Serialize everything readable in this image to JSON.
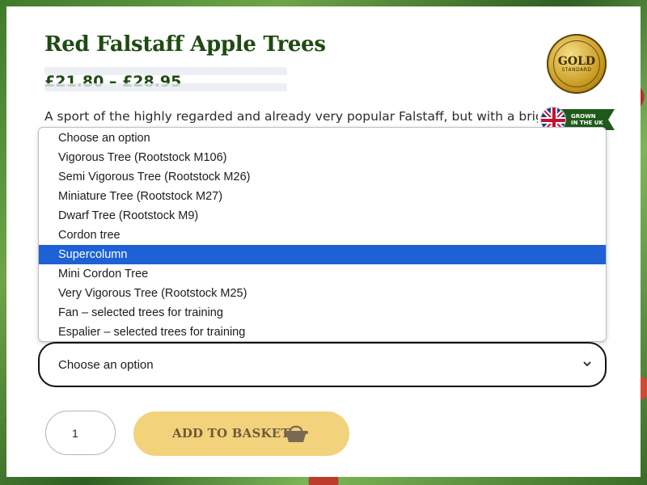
{
  "product": {
    "title": "Red Falstaff Apple Trees",
    "price": "£21.80 – £28.95",
    "description": "A sport of the highly regarded and already very popular Falstaff, but with a bright"
  },
  "badges": {
    "gold": {
      "word": "GOLD",
      "sub": "STANDARD"
    },
    "uk": {
      "line1": "GROWN",
      "line2": "IN THE UK"
    }
  },
  "rootstock_select": {
    "value": "Choose an option",
    "options": [
      "Choose an option",
      "Vigorous Tree (Rootstock M106)",
      "Semi Vigorous Tree (Rootstock M26)",
      "Miniature Tree (Rootstock M27)",
      "Dwarf Tree (Rootstock M9)",
      "Cordon tree",
      "Supercolumn",
      "Mini Cordon Tree",
      "Very Vigorous Tree (Rootstock M25)",
      "Fan – selected trees for training",
      "Espalier – selected trees for training"
    ],
    "highlighted": "Supercolumn"
  },
  "cart": {
    "quantity": "1",
    "button_label": "ADD TO BASKET"
  },
  "icons": {
    "chevron": "chevron-down-icon",
    "basket": "basket-icon",
    "flag": "uk-flag-icon",
    "seal": "gold-standard-seal"
  },
  "colors": {
    "title_green": "#1f4a12",
    "highlight_blue": "#1d61d4",
    "basket_button": "#f2d27b"
  }
}
